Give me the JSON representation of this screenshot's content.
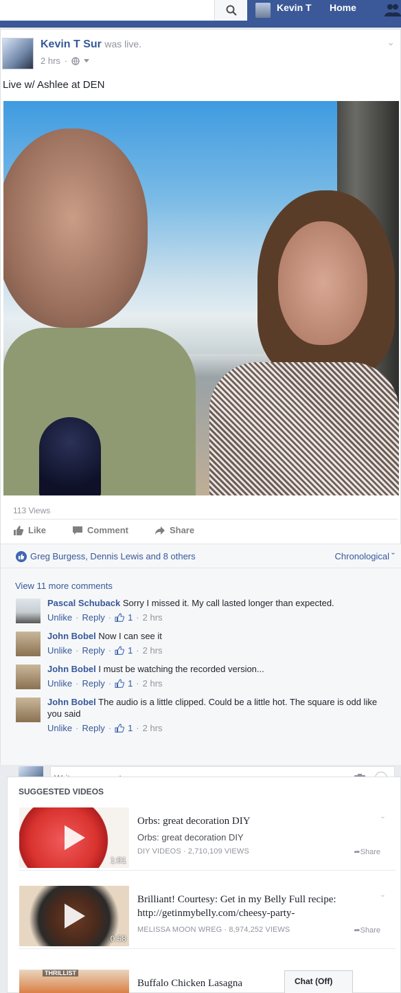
{
  "nav": {
    "user_name": "Kevin T",
    "home_label": "Home",
    "icons": [
      "search-icon",
      "friends-icon"
    ]
  },
  "post": {
    "author": "Kevin T Sur",
    "action": "was live.",
    "time": "2 hrs",
    "privacy_icon": "globe-icon",
    "text": "Live w/ Ashlee at DEN",
    "views": "113 Views",
    "actions": {
      "like": "Like",
      "comment": "Comment",
      "share": "Share"
    },
    "likers": "Greg Burgess, Dennis Lewis and 8 others",
    "order": "Chronological"
  },
  "comments": {
    "view_more": "View 11 more comments",
    "items": [
      {
        "author": "Pascal Schuback",
        "text": "Sorry I missed it. My call lasted longer than expected.",
        "unlike": "Unlike",
        "reply": "Reply",
        "likes": "1",
        "time": "2 hrs"
      },
      {
        "author": "John Bobel",
        "text": "Now I can see it",
        "unlike": "Unlike",
        "reply": "Reply",
        "likes": "1",
        "time": "2 hrs"
      },
      {
        "author": "John Bobel",
        "text": "I must be watching the recorded version...",
        "unlike": "Unlike",
        "reply": "Reply",
        "likes": "1",
        "time": "2 hrs"
      },
      {
        "author": "John Bobel",
        "text": "The audio is a little clipped. Could be a little hot. The square is odd like you said",
        "unlike": "Unlike",
        "reply": "Reply",
        "likes": "1",
        "time": "2 hrs"
      }
    ],
    "placeholder": "Write a comment..."
  },
  "suggested": {
    "title": "SUGGESTED VIDEOS",
    "share_label": "Share",
    "videos": [
      {
        "title": "Orbs: great decoration DIY",
        "subtitle": "Orbs: great decoration DIY",
        "meta": "DIY VIDEOS · 2,710,109 VIEWS",
        "duration": "1:01"
      },
      {
        "title": "Brilliant! Courtesy: Get in my Belly Full recipe: http://getinmybelly.com/cheesy-party-",
        "subtitle": "",
        "meta": "MELISSA MOON WREG · 8,974,252 VIEWS",
        "duration": "0:58"
      },
      {
        "title": "Buffalo Chicken Lasagna",
        "subtitle": "",
        "meta": "",
        "duration": "",
        "brand": "THRILLIST"
      }
    ]
  },
  "chat": {
    "label": "Chat (Off)"
  },
  "colors": {
    "brand_blue": "#3b5998",
    "link_blue": "#365899"
  }
}
